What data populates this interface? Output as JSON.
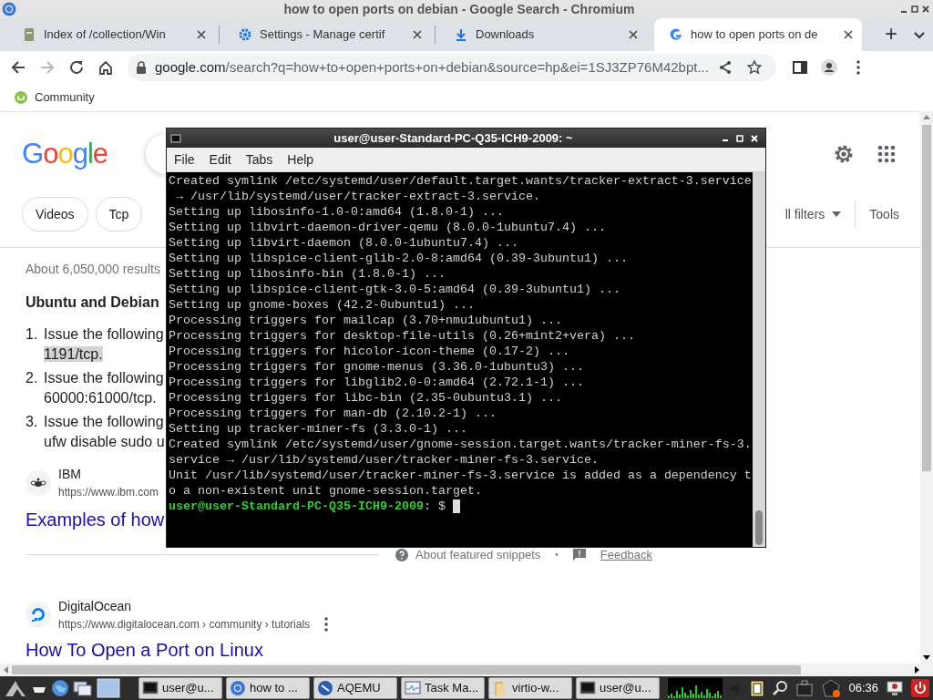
{
  "browser": {
    "title": "how to open ports on debian - Google Search - Chromium",
    "tabs": [
      {
        "kind": "file",
        "label": "Index of /collection/Win",
        "selected": false
      },
      {
        "kind": "gear",
        "label": "Settings - Manage certif",
        "selected": false
      },
      {
        "kind": "download",
        "label": "Downloads",
        "selected": false
      },
      {
        "kind": "google",
        "label": "how to open ports on de",
        "selected": true
      }
    ],
    "new_tab": "+",
    "forward_disabled": true,
    "address": {
      "host": "google.com",
      "path": "/search?q=how+to+open+ports+on+debian&source=hp&ei=1SJ3ZP76M42bpt..."
    },
    "bookmarks": [
      {
        "label": "Community"
      }
    ]
  },
  "page": {
    "logo": "Google",
    "chips": [
      "Videos",
      "Tcp"
    ],
    "all_filters": "ll filters",
    "tools": "Tools",
    "result_stats": "About 6,050,000 results",
    "snippet": {
      "heading": "Ubuntu and Debian",
      "steps": [
        {
          "number": "1.",
          "text": "Issue the following",
          "continuation": "1191/tcp.",
          "highlighted": true
        },
        {
          "number": "2.",
          "text": "Issue the following",
          "continuation": "60000:61000/tcp.",
          "highlighted": false
        },
        {
          "number": "3.",
          "text": "Issue the following",
          "continuation": "ufw disable sudo u",
          "highlighted": false
        }
      ],
      "source": {
        "site": "IBM",
        "url": "https://www.ibm.com",
        "title": "Examples of how"
      }
    },
    "footer": {
      "about": "About featured snippets",
      "separator": "•",
      "feedback": "Feedback"
    },
    "results": [
      {
        "site": "DigitalOcean",
        "url": "https://www.digitalocean.com › community › tutorials",
        "title": "How To Open a Port on Linux"
      }
    ]
  },
  "terminal": {
    "title": "user@user-Standard-PC-Q35-ICH9-2009: ~",
    "menu": [
      "File",
      "Edit",
      "Tabs",
      "Help"
    ],
    "lines": [
      "Created symlink /etc/systemd/user/default.target.wants/tracker-extract-3.service",
      " → /usr/lib/systemd/user/tracker-extract-3.service.",
      "Setting up libosinfo-1.0-0:amd64 (1.8.0-1) ...",
      "Setting up libvirt-daemon-driver-qemu (8.0.0-1ubuntu7.4) ...",
      "Setting up libvirt-daemon (8.0.0-1ubuntu7.4) ...",
      "Setting up libspice-client-glib-2.0-8:amd64 (0.39-3ubuntu1) ...",
      "Setting up libosinfo-bin (1.8.0-1) ...",
      "Setting up libspice-client-gtk-3.0-5:amd64 (0.39-3ubuntu1) ...",
      "Setting up gnome-boxes (42.2-0ubuntu1) ...",
      "Processing triggers for mailcap (3.70+nmu1ubuntu1) ...",
      "Processing triggers for desktop-file-utils (0.26+mint2+vera) ...",
      "Processing triggers for hicolor-icon-theme (0.17-2) ...",
      "Processing triggers for gnome-menus (3.36.0-1ubuntu3) ...",
      "Processing triggers for libglib2.0-0:amd64 (2.72.1-1) ...",
      "Processing triggers for libc-bin (2.35-0ubuntu3.1) ...",
      "Processing triggers for man-db (2.10.2-1) ...",
      "Setting up tracker-miner-fs (3.3.0-1) ...",
      "Created symlink /etc/systemd/user/gnome-session.target.wants/tracker-miner-fs-3.",
      "service → /usr/lib/systemd/user/tracker-miner-fs-3.service.",
      "Unit /usr/lib/systemd/user/tracker-miner-fs-3.service is added as a dependency t",
      "o a non-existent unit gnome-session.target."
    ],
    "prompt": {
      "user_host": "user@user-Standard-PC-Q35-ICH9-2009",
      "suffix": ": $"
    }
  },
  "taskbar": {
    "tasks": [
      {
        "kind": "terminal",
        "label": "user@u...",
        "selected": false
      },
      {
        "kind": "chromium",
        "label": "how to ...",
        "selected": false
      },
      {
        "kind": "qemu",
        "label": "AQEMU",
        "selected": false
      },
      {
        "kind": "monitor",
        "label": "Task Ma...",
        "selected": false
      },
      {
        "kind": "folder",
        "label": "virtio-w...",
        "selected": false
      },
      {
        "kind": "terminal",
        "label": "user@u...",
        "selected": false
      }
    ],
    "clock": "06:36"
  }
}
